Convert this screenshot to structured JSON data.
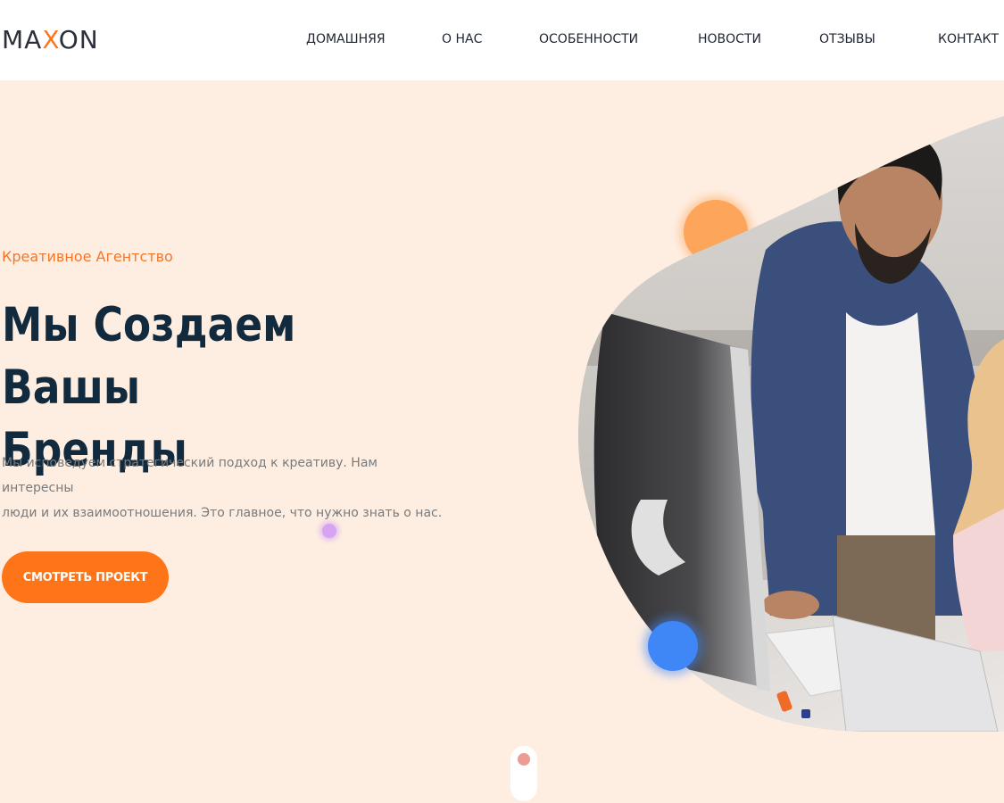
{
  "brand": {
    "logo_part1": "MA",
    "logo_accent": "X",
    "logo_part2": "ON",
    "accent_color": "#fe7418"
  },
  "nav": {
    "items": [
      {
        "label": "ДОМАШНЯЯ"
      },
      {
        "label": "О НАС"
      },
      {
        "label": "ОСОБЕННОСТИ"
      },
      {
        "label": "НОВОСТИ"
      },
      {
        "label": "ОТЗЫВЫ"
      },
      {
        "label": "КОНТАКТ"
      }
    ]
  },
  "hero": {
    "kicker": "Креативное Агентство",
    "title_line1": "Мы Создаем Вашы",
    "title_line2": "Бренды",
    "description_line1": "Мы исповедуем стратегический подход к креативу. Нам интересны",
    "description_line2": "люди и их взаимоотношения. Это главное, что нужно знать о нас.",
    "cta_label": "СМОТРЕТЬ ПРОЕКТ",
    "background_color": "#feeee2",
    "title_color": "#112a3e"
  },
  "image": {
    "subject": "two-people-at-computers-photo"
  }
}
